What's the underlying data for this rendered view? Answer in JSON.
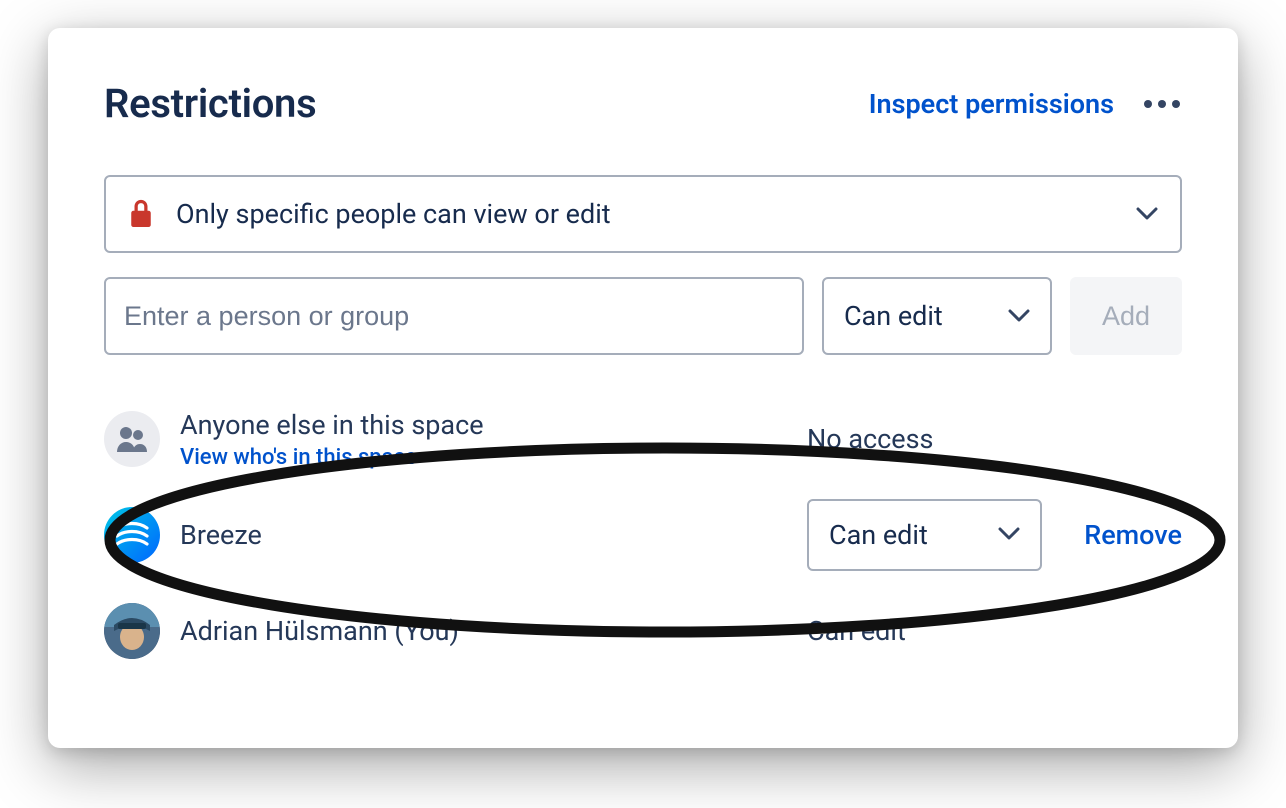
{
  "header": {
    "title": "Restrictions",
    "inspect_label": "Inspect permissions"
  },
  "restriction_dropdown": {
    "selected": "Only specific people can view or edit"
  },
  "add_form": {
    "input_placeholder": "Enter a person or group",
    "permission_selected": "Can edit",
    "add_button_label": "Add"
  },
  "rows": {
    "anyone_else": {
      "name": "Anyone else in this space",
      "view_link": "View who's in this space",
      "permission": "No access"
    },
    "breeze": {
      "name": "Breeze",
      "permission_selected": "Can edit",
      "remove_label": "Remove"
    },
    "current_user": {
      "name": "Adrian Hülsmann (You)",
      "permission": "Can edit"
    }
  }
}
